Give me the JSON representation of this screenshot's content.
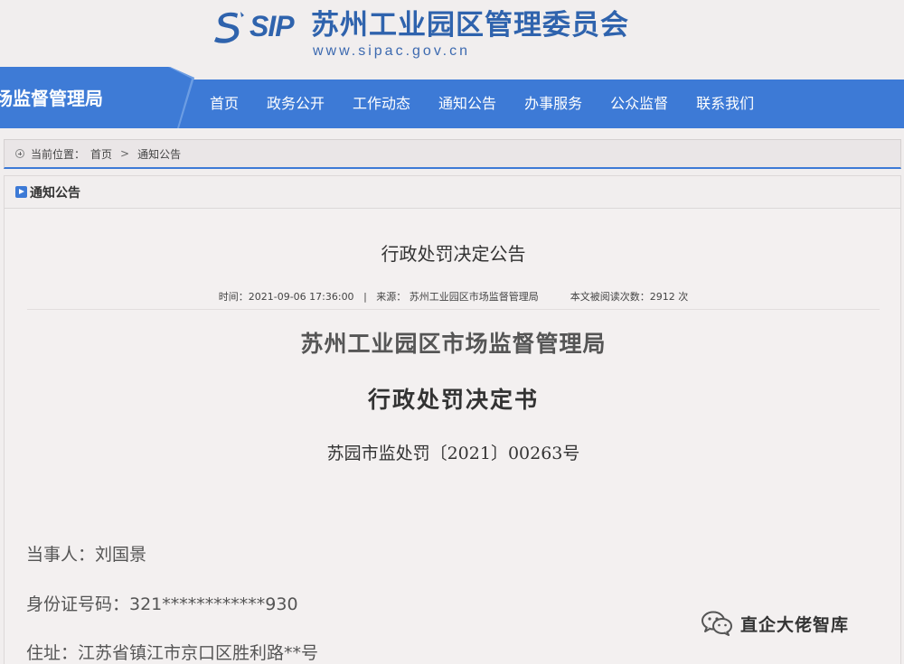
{
  "header": {
    "logo_text": "SIP",
    "site_title": "苏州工业园区管理委员会",
    "site_url": "www.sipac.gov.cn"
  },
  "nav": {
    "department": "场监督管理局",
    "items": [
      "首页",
      "政务公开",
      "工作动态",
      "通知公告",
      "办事服务",
      "公众监督",
      "联系我们"
    ]
  },
  "breadcrumb": {
    "label": "当前位置：",
    "items": [
      "首页",
      "通知公告"
    ],
    "separator": ">"
  },
  "section": {
    "title": "通知公告"
  },
  "article": {
    "title": "行政处罚决定公告",
    "meta": {
      "time": "时间：2021-09-06 17:36:00",
      "divider": "|",
      "source": "来源： 苏州工业园区市场监督管理局",
      "views": "本文被阅读次数：2912 次"
    },
    "org": "苏州工业园区市场监督管理局",
    "doc_kind": "行政处罚决定书",
    "doc_no": "苏园市监处罚〔2021〕00263号",
    "fields": [
      "当事人：刘国景",
      "身份证号码：321************930",
      "住址：江苏省镇江市京口区胜利路**号"
    ]
  },
  "watermark": {
    "text": "直企大佬智库",
    "icon": "wechat-icon"
  },
  "colors": {
    "brand": "#2f63ad",
    "nav": "#3d7ad6",
    "background": "#f1eeee"
  }
}
